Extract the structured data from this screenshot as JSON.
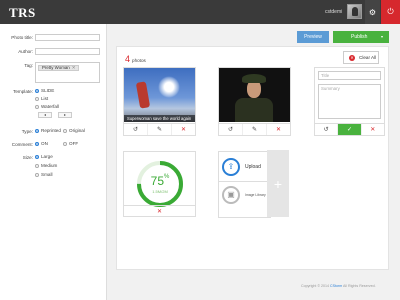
{
  "header": {
    "logo": "TRS",
    "username": "cstdemi",
    "settings_icon": "gear-icon",
    "power_icon": "power-icon"
  },
  "sidebar": {
    "photo_title_label": "Photo title:",
    "photo_title_value": "",
    "author_label": "Author:",
    "author_value": "",
    "tag_label": "Tag:",
    "tags": [
      "Pretty Woman"
    ],
    "template_label": "Template:",
    "template_options": [
      "SLIDE",
      "List",
      "Waterfall"
    ],
    "template_selected": "SLIDE",
    "type_label": "Type:",
    "type_options": [
      "Reprinted",
      "Original"
    ],
    "type_selected": "Reprinted",
    "comment_label": "Comment:",
    "comment_options": [
      "ON",
      "OFF"
    ],
    "comment_selected": "ON",
    "size_label": "Size:",
    "size_options": [
      "Large",
      "Medium",
      "Small"
    ],
    "size_selected": "Large",
    "arrow_left": "◂",
    "arrow_right": "▸"
  },
  "toolbar": {
    "preview_label": "Preview",
    "publish_label": "Publish",
    "publish_caret": "▾"
  },
  "content": {
    "photo_count": "4",
    "photo_count_label": "photos",
    "clear_all_label": "Clear All",
    "photos": [
      {
        "caption": "Superwoman save the world again"
      },
      {
        "caption": ""
      }
    ],
    "new_photo": {
      "title_placeholder": "Title",
      "summary_placeholder": "Summary"
    },
    "upload_progress": {
      "percent_value": 75,
      "percent": "75",
      "percent_sign": "%",
      "size_text": "1.5M/2M"
    },
    "upload_label": "Upload",
    "image_library_label": "Image Library",
    "add_symbol": "+"
  },
  "icons": {
    "rotate": "↺",
    "edit": "✎",
    "delete": "✕",
    "confirm": "✓",
    "clear": "✕"
  },
  "footer": {
    "text_before": "Copyright © 2014",
    "brand": "CStorm",
    "text_after": "All Rights Reserved."
  },
  "colors": {
    "topbar": "#3a3a3a",
    "preview": "#5b9bd5",
    "publish": "#49b23e",
    "danger": "#d9282d",
    "progress": "#3aaa35"
  }
}
